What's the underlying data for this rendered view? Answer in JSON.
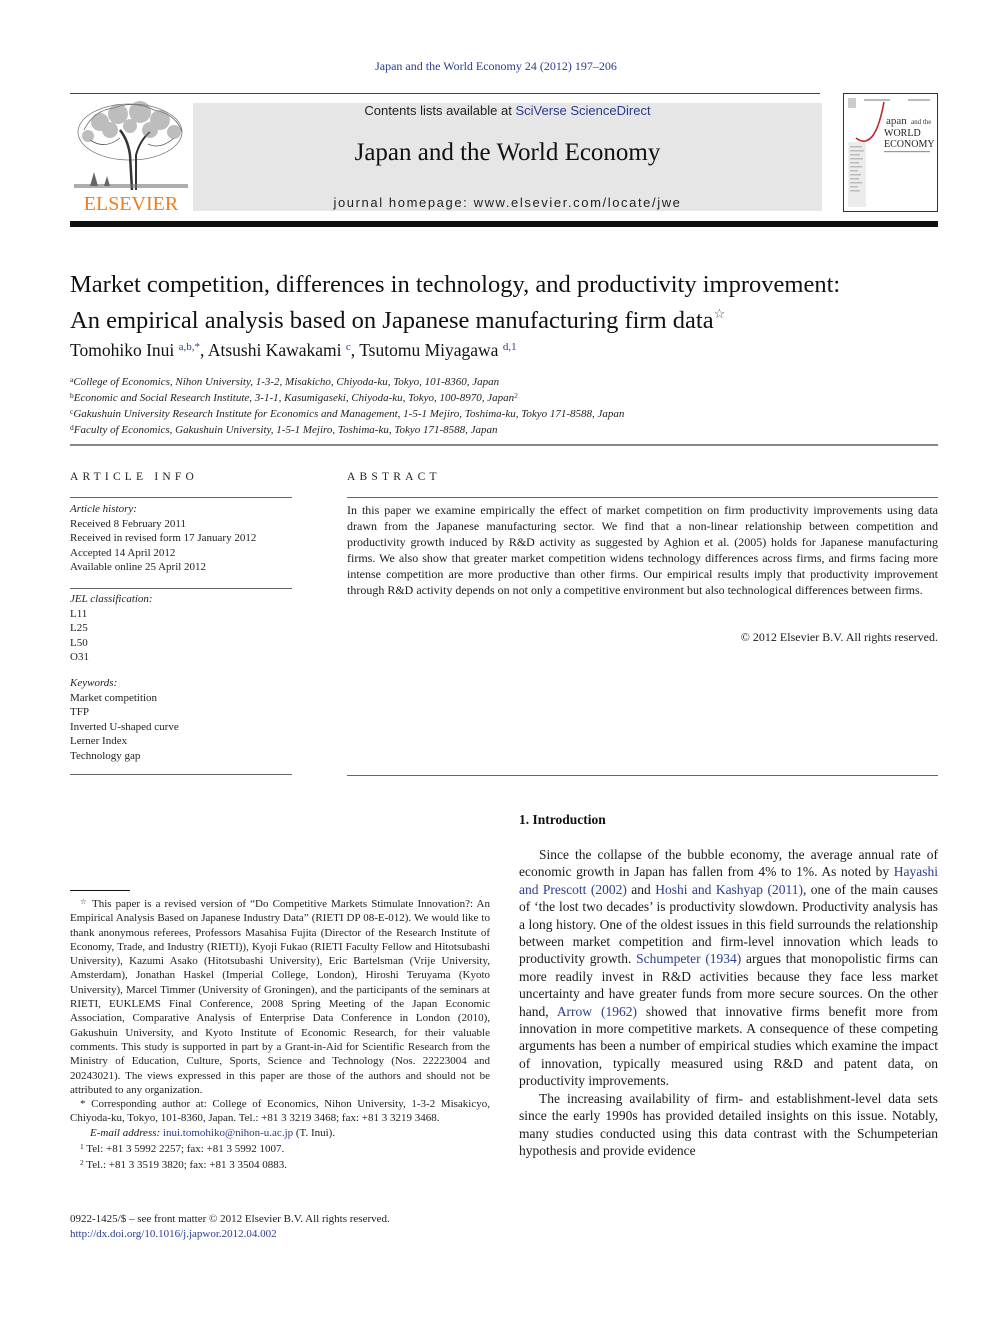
{
  "running_head": "Japan and the World Economy 24 (2012) 197–206",
  "publisher": {
    "name": "ELSEVIER",
    "logo_icon": "elsevier-tree-icon",
    "brand_color": "#f07d1a"
  },
  "masthead": {
    "contents_prefix": "Contents lists available at ",
    "contents_link": "SciVerse ScienceDirect",
    "journal_title": "Japan and the World Economy",
    "homepage": "journal homepage: www.elsevier.com/locate/jwe",
    "background_color": "#e6e6e6"
  },
  "cover": {
    "title_line1": "Japan",
    "title_line1_suffix": "and the",
    "title_line2": "WORLD",
    "title_line3": "ECONOMY"
  },
  "article": {
    "title_line1": "Market competition, differences in technology, and productivity improvement:",
    "title_line2": "An empirical analysis based on Japanese manufacturing firm data",
    "title_note_mark": "☆",
    "authors": [
      {
        "name": "Tomohiko Inui",
        "marks": "a,b,*",
        "sep": ", "
      },
      {
        "name": "Atsushi Kawakami",
        "marks": "c",
        "sep": ", "
      },
      {
        "name": "Tsutomu Miyagawa",
        "marks": "d,1",
        "sep": ""
      }
    ],
    "affiliations": [
      {
        "mark": "a",
        "text": "College of Economics, Nihon University, 1-3-2, Misakicho, Chiyoda-ku, Tokyo, 101-8360, Japan",
        "note": ""
      },
      {
        "mark": "b",
        "text": "Economic and Social Research Institute, 3-1-1, Kasumigaseki, Chiyoda-ku, Tokyo, 100-8970, Japan",
        "note": "2"
      },
      {
        "mark": "c",
        "text": "Gakushuin University Research Institute for Economics and Management, 1-5-1 Mejiro, Toshima-ku, Tokyo 171-8588, Japan",
        "note": ""
      },
      {
        "mark": "d",
        "text": "Faculty of Economics, Gakushuin University, 1-5-1 Mejiro, Toshima-ku, Tokyo 171-8588, Japan",
        "note": ""
      }
    ]
  },
  "article_info": {
    "label": "ARTICLE INFO",
    "history_heading": "Article history:",
    "history": [
      "Received 8 February 2011",
      "Received in revised form 17 January 2012",
      "Accepted 14 April 2012",
      "Available online 25 April 2012"
    ],
    "jel_heading": "JEL classification:",
    "jel": [
      "L11",
      "L25",
      "L50",
      "O31"
    ],
    "keywords_heading": "Keywords:",
    "keywords": [
      "Market competition",
      "TFP",
      "Inverted U-shaped curve",
      "Lerner Index",
      "Technology gap"
    ]
  },
  "abstract": {
    "label": "ABSTRACT",
    "text": "In this paper we examine empirically the effect of market competition on firm productivity improvements using data drawn from the Japanese manufacturing sector. We find that a non-linear relationship between competition and productivity growth induced by R&D activity as suggested by Aghion et al. (2005) holds for Japanese manufacturing firms. We also show that greater market competition widens technology differences across firms, and firms facing more intense competition are more productive than other firms. Our empirical results imply that productivity improvement through R&D activity depends on not only a competitive environment but also technological differences between firms.",
    "copyright": "© 2012 Elsevier B.V. All rights reserved."
  },
  "introduction": {
    "heading": "1.  Introduction",
    "p1": [
      {
        "t": "Since the collapse of the bubble economy, the average annual rate of economic growth in Japan has fallen from 4% to 1%. As noted by "
      },
      {
        "t": "Hayashi and Prescott (2002)",
        "link": true
      },
      {
        "t": " and "
      },
      {
        "t": "Hoshi and Kashyap (2011)",
        "link": true
      },
      {
        "t": ", one of the main causes of ‘the lost two decades’ is productivity slowdown. Productivity analysis has a long history. One of the oldest issues in this field surrounds the relationship between market competition and firm-level innovation which leads to productivity growth. "
      },
      {
        "t": "Schumpeter (1934)",
        "link": true
      },
      {
        "t": " argues that monopolistic firms can more readily invest in R&D activities because they face less market uncertainty and have greater funds from more secure sources. On the other hand, "
      },
      {
        "t": "Arrow (1962)",
        "link": true
      },
      {
        "t": " showed that innovative firms benefit more from innovation in more competitive markets. A consequence of these competing arguments has been a number of empirical studies which examine the impact of innovation, typically measured using R&D and patent data, on productivity improvements."
      }
    ],
    "p2": "The increasing availability of firm- and establishment-level data sets since the early 1990s has provided detailed insights on this issue. Notably, many studies conducted using this data contrast with the Schumpeterian hypothesis and provide evidence"
  },
  "footnotes": {
    "star_mark": "☆",
    "star_note": " This paper is a revised version of “Do Competitive Markets Stimulate Innovation?: An Empirical Analysis Based on Japanese Industry Data” (RIETI DP 08-E-012). We would like to thank anonymous referees, Professors Masahisa Fujita (Director of the Research Institute of Economy, Trade, and Industry (RIETI)), Kyoji Fukao (RIETI Faculty Fellow and Hitotsubashi University), Kazumi Asako (Hitotsubashi University), Eric Bartelsman (Vrije University, Amsterdam), Jonathan Haskel (Imperial College, London), Hiroshi Teruyama (Kyoto University), Marcel Timmer (University of Groningen), and the participants of the seminars at RIETI, EUKLEMS Final Conference, 2008 Spring Meeting of the Japan Economic Association, Comparative Analysis of Enterprise Data Conference in London (2010), Gakushuin University, and Kyoto Institute of Economic Research, for their valuable comments. This study is supported in part by a Grant-in-Aid for Scientific Research from the Ministry of Education, Culture, Sports, Science and Technology (Nos. 22223004 and 20243021). The views expressed in this paper are those of the authors and should not be attributed to any organization.",
    "corresponding": "* Corresponding author at: College of Economics, Nihon University, 1-3-2 Misakicyo, Chiyoda-ku, Tokyo, 101-8360, Japan. Tel.: +81 3 3219 3468; fax: +81 3 3219 3468.",
    "email_label": "E-mail address:",
    "email": "inui.tomohiko@nihon-u.ac.jp",
    "email_suffix": " (T. Inui).",
    "fn1_mark": "1",
    "fn1": " Tel: +81 3 5992 2257; fax: +81 3 5992 1007.",
    "fn2_mark": "2",
    "fn2": " Tel.: +81 3 3519 3820; fax: +81 3 3504 0883."
  },
  "front_matter": {
    "issn_line": "0922-1425/$ – see front matter © 2012 Elsevier B.V. All rights reserved.",
    "doi": "http://dx.doi.org/10.1016/j.japwor.2012.04.002"
  },
  "colors": {
    "link": "#2a3c8f",
    "text": "#1a1a1a"
  }
}
